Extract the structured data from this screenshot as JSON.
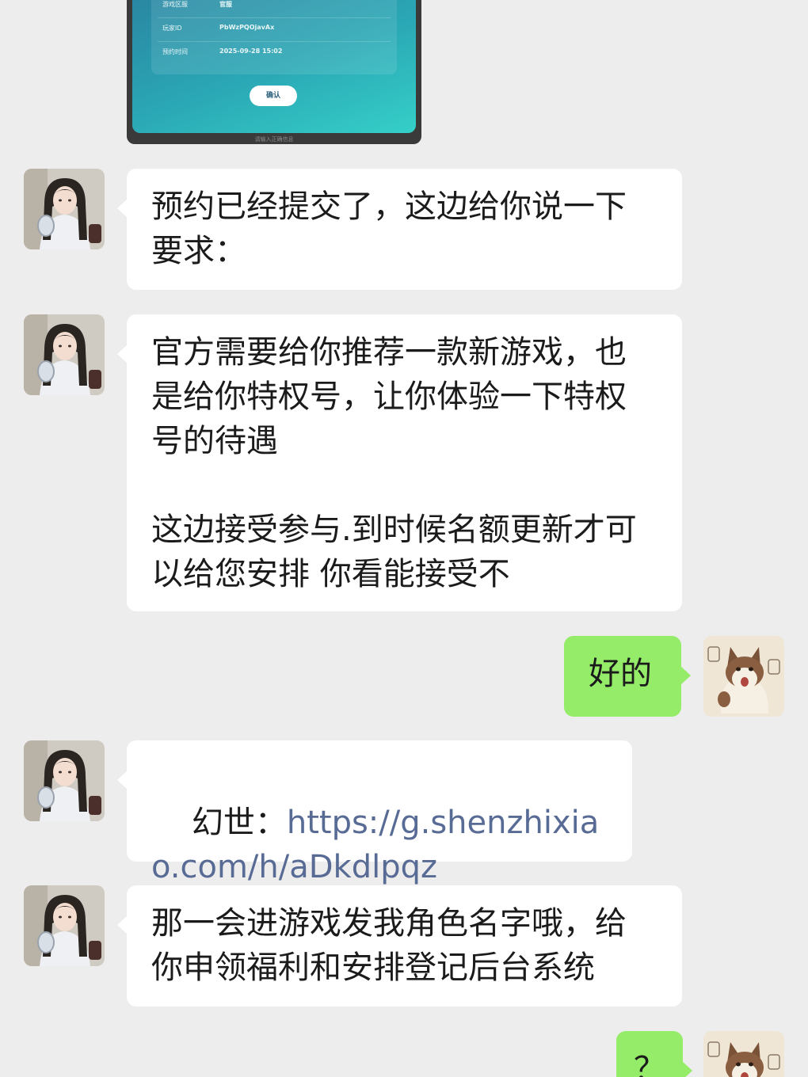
{
  "shared_image": {
    "rows": [
      {
        "key": "游戏区服",
        "value": "官服"
      },
      {
        "key": "玩家ID",
        "value": "PbWzPQOjavAx"
      },
      {
        "key": "预约时间",
        "value": "2025-09-28 15:02"
      }
    ],
    "confirm_label": "确认",
    "caption": "请输入正确信息"
  },
  "messages": [
    {
      "side": "in",
      "text": "预约已经提交了，这边给你说一下要求："
    },
    {
      "side": "in",
      "text": "官方需要给你推荐一款新游戏，也是给你特权号，让你体验一下特权号的待遇\n\n这边接受参与.到时候名额更新才可以给您安排 你看能接受不"
    },
    {
      "side": "out",
      "text": "好的"
    },
    {
      "side": "in",
      "prefix": "幻世：",
      "link": "https://g.shenzhixiao.com/h/aDkdlpqz"
    },
    {
      "side": "in",
      "text": "那一会进游戏发我角色名字哦，给你申领福利和安排登记后台系统"
    },
    {
      "side": "out",
      "text": "？"
    }
  ],
  "colors": {
    "background": "#ededed",
    "incoming_bubble": "#ffffff",
    "outgoing_bubble": "#95ec69",
    "link": "#576b95"
  },
  "icons": {
    "contact_avatar": "girl-photo-avatar",
    "self_avatar": "cat-illustration-avatar"
  }
}
